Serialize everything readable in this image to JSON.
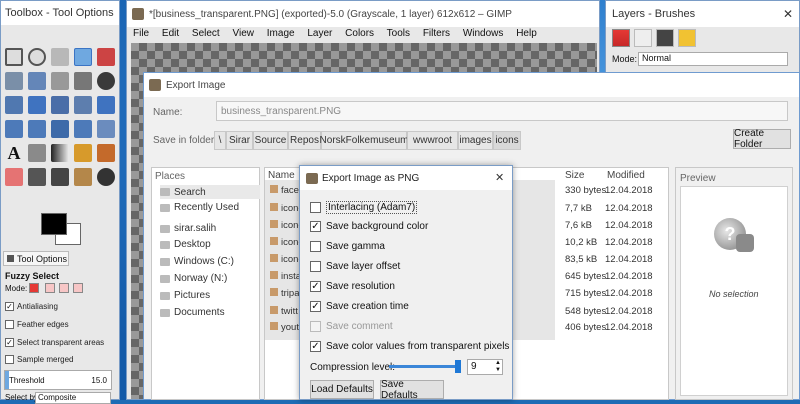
{
  "toolbox": {
    "title": "Toolbox - Tool Options",
    "tab_label": "Tool Options",
    "tool_name": "Fuzzy Select",
    "mode_label": "Mode:",
    "options": [
      {
        "label": "Antialiasing",
        "checked": true
      },
      {
        "label": "Feather edges",
        "checked": false
      },
      {
        "label": "Select transparent areas",
        "checked": true
      },
      {
        "label": "Sample merged",
        "checked": false
      }
    ],
    "threshold_label": "Threshold",
    "threshold_value": "15.0",
    "select_by_label": "Select by",
    "select_by_value": "Composite",
    "fg_color": "#000000",
    "bg_color": "#ffffff"
  },
  "gimp_main": {
    "title": "*[business_transparent.PNG] (exported)-5.0 (Grayscale, 1 layer) 612x612 – GIMP",
    "menu": [
      "File",
      "Edit",
      "Select",
      "View",
      "Image",
      "Layer",
      "Colors",
      "Tools",
      "Filters",
      "Windows",
      "Help"
    ]
  },
  "layers": {
    "title": "Layers - Brushes",
    "mode_label": "Mode:",
    "mode_value": "Normal"
  },
  "export": {
    "title": "Export Image",
    "name_label": "Name:",
    "name_value": "business_transparent.PNG",
    "save_in_label": "Save in folder:",
    "path": [
      "\\",
      "Sirar",
      "Source",
      "Repos",
      "NorskFolkemuseum",
      "wwwroot",
      "images",
      "icons"
    ],
    "create_folder": "Create Folder",
    "places_header": "Places",
    "places": [
      "Search",
      "Recently Used",
      "sirar.salih",
      "Desktop",
      "Windows (C:)",
      "Norway (N:)",
      "Pictures",
      "Documents"
    ],
    "name_header": "Name",
    "size_header": "Size",
    "modified_header": "Modified",
    "files": [
      {
        "name": "faceb",
        "size": "330 bytes",
        "date": "12.04.2018"
      },
      {
        "name": "icon-",
        "size": "7,7 kB",
        "date": "12.04.2018"
      },
      {
        "name": "icon-",
        "size": "7,6 kB",
        "date": "12.04.2018"
      },
      {
        "name": "icon-",
        "size": "10,2 kB",
        "date": "12.04.2018"
      },
      {
        "name": "icon-",
        "size": "83,5 kB",
        "date": "12.04.2018"
      },
      {
        "name": "insta",
        "size": "645 bytes",
        "date": "12.04.2018"
      },
      {
        "name": "tripa",
        "size": "715 bytes",
        "date": "12.04.2018"
      },
      {
        "name": "twitt",
        "size": "548 bytes",
        "date": "12.04.2018"
      },
      {
        "name": "yout",
        "size": "406 bytes",
        "date": "12.04.2018"
      }
    ],
    "preview_header": "Preview",
    "no_selection": "No selection"
  },
  "png_dialog": {
    "title": "Export Image as PNG",
    "options": [
      {
        "label": "Interlacing (Adam7)",
        "checked": false,
        "disabled": false
      },
      {
        "label": "Save background color",
        "checked": true,
        "disabled": false
      },
      {
        "label": "Save gamma",
        "checked": false,
        "disabled": false
      },
      {
        "label": "Save layer offset",
        "checked": false,
        "disabled": false
      },
      {
        "label": "Save resolution",
        "checked": true,
        "disabled": false
      },
      {
        "label": "Save creation time",
        "checked": true,
        "disabled": false
      },
      {
        "label": "Save comment",
        "checked": false,
        "disabled": true
      },
      {
        "label": "Save color values from transparent pixels",
        "checked": true,
        "disabled": false
      }
    ],
    "compression_label": "Compression level:",
    "compression_value": "9",
    "compression_level": 1.0,
    "load_defaults": "Load Defaults",
    "save_defaults": "Save Defaults"
  }
}
